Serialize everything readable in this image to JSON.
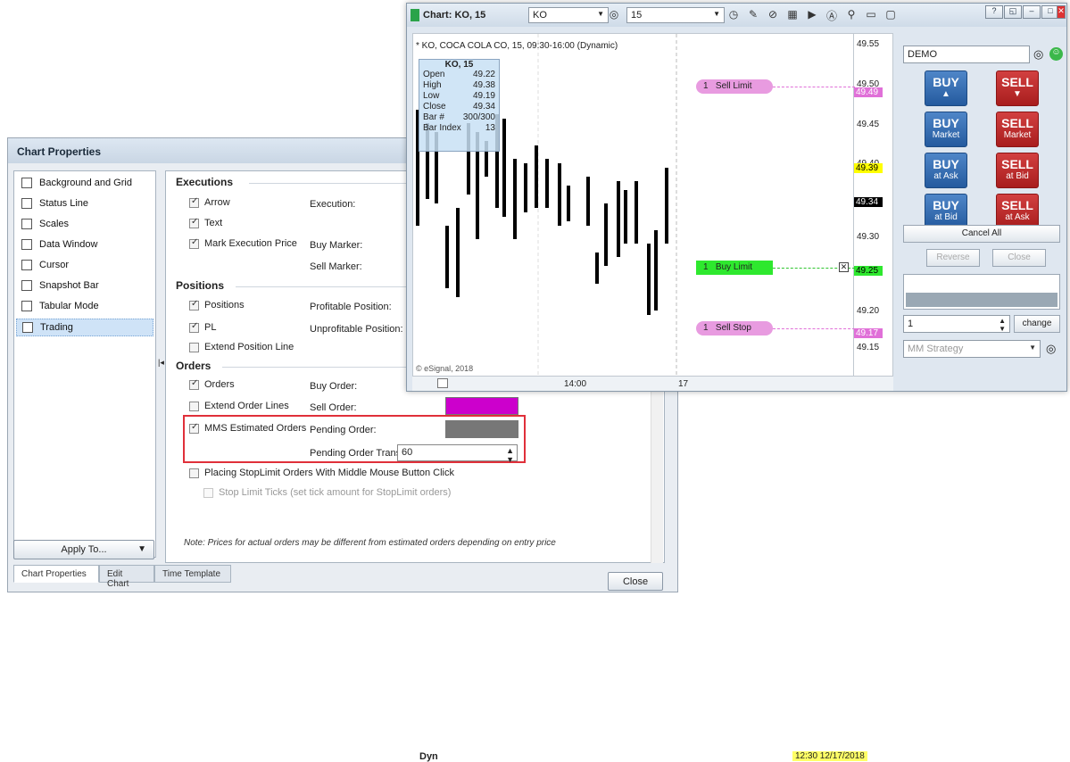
{
  "props": {
    "title": "Chart Properties",
    "nav": [
      {
        "label": "Background and Grid"
      },
      {
        "label": "Status Line"
      },
      {
        "label": "Scales"
      },
      {
        "label": "Data Window"
      },
      {
        "label": "Cursor"
      },
      {
        "label": "Snapshot Bar"
      },
      {
        "label": "Tabular Mode"
      },
      {
        "label": "Trading"
      }
    ],
    "apply_label": "Apply To...",
    "sections": {
      "executions": "Executions",
      "positions": "Positions",
      "orders": "Orders"
    },
    "checks": {
      "arrow": "Arrow",
      "text": "Text",
      "mark_exec": "Mark Execution Price",
      "positions": "Positions",
      "pl": "PL",
      "extend_pos": "Extend Position Line",
      "orders": "Orders",
      "extend_orders": "Extend Order Lines",
      "mms": "MMS Estimated Orders",
      "placing": "Placing StopLimit Orders With Middle Mouse Button Click",
      "stop_ticks": "Stop Limit Ticks (set tick amount for StopLimit orders)"
    },
    "fields": {
      "execution": "Execution:",
      "buy_marker": "Buy Marker:",
      "sell_marker": "Sell Marker:",
      "profitable": "Profitable Position:",
      "unprofitable": "Unprofitable Position:",
      "buy_order": "Buy Order:",
      "sell_order": "Sell Order:",
      "pending": "Pending Order:",
      "pending_trans": "Pending Order Transparency:"
    },
    "transparency_value": "60",
    "note": "Note: Prices for actual orders may be different from estimated orders depending on entry price",
    "tabs": [
      "Chart Properties",
      "Edit Chart",
      "Time Template"
    ],
    "close_label": "Close",
    "colors": {
      "sell_order": "#cc00cc",
      "pending": "#777777",
      "highlight": "#e0303a"
    }
  },
  "chart": {
    "title": "Chart: KO, 15",
    "symbol": "KO",
    "interval": "15",
    "info": "* KO, COCA COLA CO, 15, 09:30-16:00 (Dynamic)",
    "ohlc": {
      "head": "KO, 15",
      "rows": [
        [
          "Open",
          "49.22"
        ],
        [
          "High",
          "49.38"
        ],
        [
          "Low",
          "49.19"
        ],
        [
          "Close",
          "49.34"
        ],
        [
          "Bar #",
          "300/300"
        ],
        [
          "Bar Index",
          "13"
        ]
      ]
    },
    "prices": [
      "49.55",
      "49.50",
      "49.45",
      "49.40",
      "49.35",
      "49.30",
      "49.25",
      "49.20",
      "49.15"
    ],
    "price_tags": {
      "sell_limit": "49.49",
      "last_a": "49.39",
      "last_b": "49.34",
      "buy_limit": "49.25",
      "sell_stop": "49.17"
    },
    "orders": {
      "sell_limit": {
        "qty": "1",
        "label": "Sell Limit"
      },
      "buy_limit": {
        "qty": "1",
        "label": "Buy Limit"
      },
      "sell_stop": {
        "qty": "1",
        "label": "Sell Stop"
      }
    },
    "copyright": "© eSignal, 2018",
    "x_labels": [
      "14:00",
      "17"
    ],
    "dyn": "Dyn",
    "time_readout": "12:30 12/17/2018"
  },
  "trade": {
    "account": "DEMO",
    "buttons": [
      {
        "big": "BUY",
        "sm": "▲",
        "side": "buy"
      },
      {
        "big": "SELL",
        "sm": "▼",
        "side": "sell"
      },
      {
        "big": "BUY",
        "sm": "Market",
        "side": "buy"
      },
      {
        "big": "SELL",
        "sm": "Market",
        "side": "sell"
      },
      {
        "big": "BUY",
        "sm": "at Ask",
        "side": "buy"
      },
      {
        "big": "SELL",
        "sm": "at Bid",
        "side": "sell"
      },
      {
        "big": "BUY",
        "sm": "at Bid",
        "side": "buy"
      },
      {
        "big": "SELL",
        "sm": "at Ask",
        "side": "sell"
      }
    ],
    "cancel_all": "Cancel All",
    "reverse": "Reverse",
    "close": "Close",
    "qty": "1",
    "change": "change",
    "strategy_placeholder": "MM Strategy"
  }
}
